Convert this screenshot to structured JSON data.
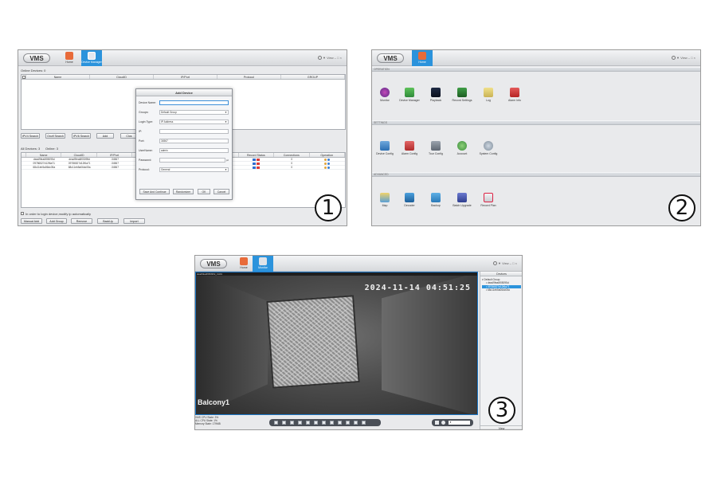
{
  "app": {
    "logo": "VMS",
    "view_label": "View"
  },
  "shot1": {
    "tabs": [
      {
        "label": "Home"
      },
      {
        "label": "Device Manager"
      }
    ],
    "online_devices_label": "Online Devices:",
    "online_devices_count": "0",
    "online_columns": [
      "Name",
      "CloudID",
      "IP/Port",
      "Protocol",
      "GROUP"
    ],
    "search_buttons": [
      "IPV4 Search",
      "Onvif Search",
      "IPV6 Search",
      "Add",
      "Clos"
    ],
    "all_devices_label": "All Devices:",
    "all_devices_count": "3",
    "online_label": "Online:",
    "online_count": "3",
    "device_columns": [
      "Name",
      "CloudID",
      "IP/Port",
      "...",
      "nect",
      "Pixel Status",
      "Record Status",
      "Connections",
      "Operation"
    ],
    "devices": [
      {
        "name": "dead9fea6f05095d",
        "cloud_id": "dead9fea6f05095d",
        "ip": ":34567",
        "state": "ccess",
        "connections": "0"
      },
      {
        "name": "09786527d12f6a71",
        "cloud_id": "09786527d12f6a71",
        "ip": ":34567",
        "state": "ccess",
        "connections": "0"
      },
      {
        "name": "68c11eb5a06dc05a",
        "cloud_id": "68c11eb5a06dc05a",
        "ip": ":34567",
        "state": "ccess",
        "connections": "0"
      }
    ],
    "auto_login_label": "In order to login device,modify ip automatically",
    "bottom_buttons": [
      "Manual Add",
      "Add Group",
      "Remove",
      "BackUp",
      "Import"
    ],
    "dialog": {
      "title": "Add Device",
      "fields": [
        {
          "label": "Device Name:",
          "value": ""
        },
        {
          "label": "Groups:",
          "value": "Default Group"
        },
        {
          "label": "Login Type:",
          "value": "IP Address"
        },
        {
          "label": "IP:",
          "value": ""
        },
        {
          "label": "Port:",
          "value": "34567"
        },
        {
          "label": "UserName:",
          "value": "admin"
        },
        {
          "label": "Password:",
          "value": "",
          "unit": "pz"
        },
        {
          "label": "Protocol:",
          "value": "General"
        }
      ],
      "buttons": [
        "Save And Continue",
        "Randomizer",
        "OK",
        "Cancel"
      ]
    }
  },
  "shot2": {
    "tabs": [
      {
        "label": "Home"
      }
    ],
    "sections": [
      {
        "title": "OPERATION",
        "items": [
          "Monitor",
          "Device Manager",
          "Playback",
          "Record Settings",
          "Log",
          "Alarm Info"
        ]
      },
      {
        "title": "SETTINGS",
        "items": [
          "Device Config",
          "Alarm Config",
          "Tour Config",
          "Account",
          "System Config"
        ]
      },
      {
        "title": "ADVANCED",
        "items": [
          "Map",
          "Decoder",
          "Backup",
          "Batch Upgrade",
          "Record Plan"
        ]
      }
    ]
  },
  "shot3": {
    "tabs": [
      {
        "label": "Home"
      },
      {
        "label": "Monitor"
      }
    ],
    "video_title": "dead9fea6f05095d_CH01",
    "timestamp": "2024-11-14 04:51:25",
    "camera_name": "Balcony1",
    "panel_title": "Devices",
    "panel_footer": "View",
    "tree": [
      "Default Group",
      "dead9fea6f05095d",
      "09786527d12f6a71",
      "68c11eb5a06dc05a"
    ],
    "stats": [
      "VMS CPU State:",
      "ALL CPU State:",
      "Memory State:"
    ],
    "stat_values": [
      "3%",
      "1%",
      "179MB"
    ]
  },
  "badges": [
    "1",
    "2",
    "3"
  ],
  "colors": {
    "accent": "#2b93dc",
    "home_icon": "#e86b3a",
    "alarm_red": "#d93b3b"
  }
}
